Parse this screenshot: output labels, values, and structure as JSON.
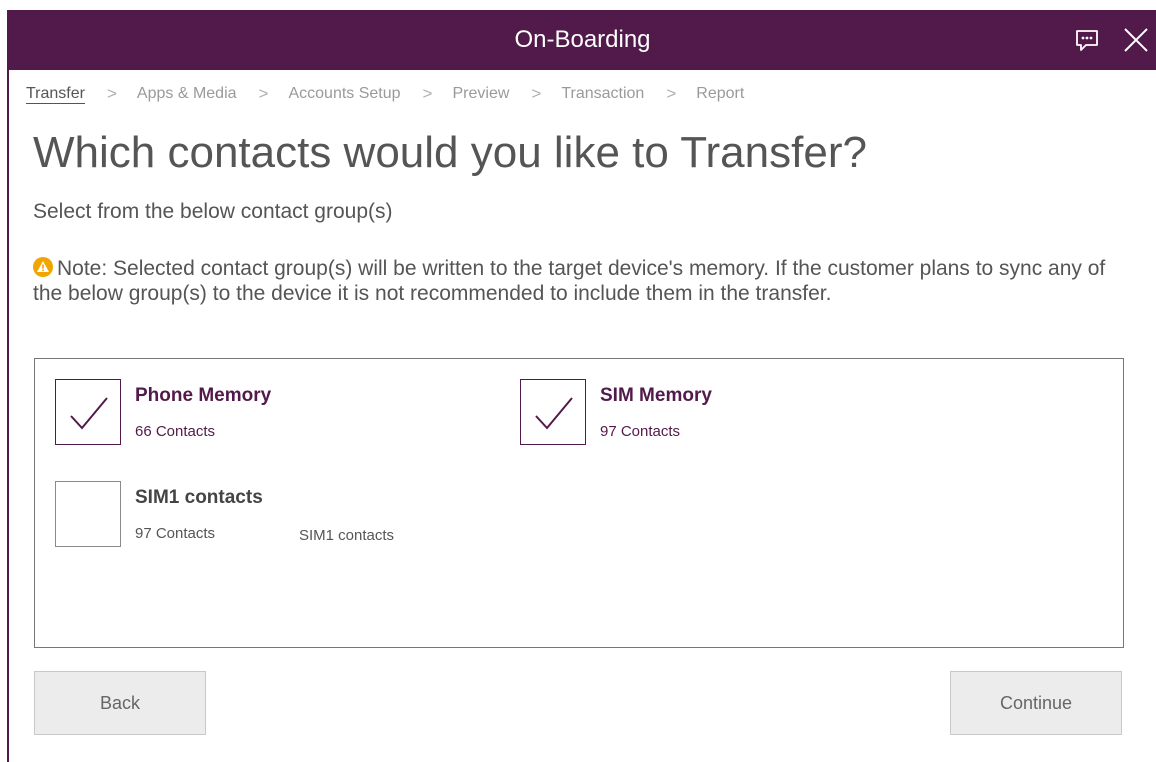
{
  "window": {
    "title": "On-Boarding"
  },
  "breadcrumb": [
    {
      "label": "Transfer",
      "active": true
    },
    {
      "label": "Apps & Media",
      "active": false
    },
    {
      "label": "Accounts Setup",
      "active": false
    },
    {
      "label": "Preview",
      "active": false
    },
    {
      "label": "Transaction",
      "active": false
    },
    {
      "label": "Report",
      "active": false
    }
  ],
  "breadcrumb_separator": ">",
  "main": {
    "heading": "Which contacts would you like to Transfer?",
    "subheading": "Select from the below contact group(s)",
    "note": "Note: Selected contact group(s) will be written to the target device's memory. If the customer plans to sync any of the below group(s) to the device it is not recommended to include them in the transfer."
  },
  "groups": [
    {
      "name": "Phone Memory",
      "count": "66 Contacts",
      "checked": true
    },
    {
      "name": "SIM Memory",
      "count": "97 Contacts",
      "checked": true
    },
    {
      "name": "SIM1 contacts",
      "count": "97 Contacts",
      "extra": "SIM1 contacts",
      "checked": false
    }
  ],
  "buttons": {
    "back": "Back",
    "continue": "Continue"
  },
  "colors": {
    "accent": "#521a4a",
    "warning": "#f0a500"
  },
  "icons": {
    "feedback": "feedback-icon",
    "close": "close-icon",
    "warning": "warning-icon",
    "check": "checkmark-icon"
  }
}
